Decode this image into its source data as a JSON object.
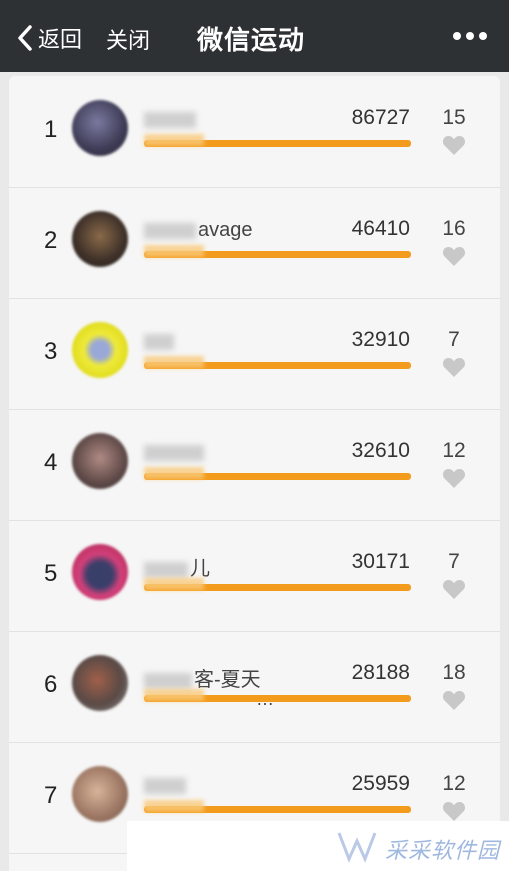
{
  "header": {
    "back_label": "返回",
    "close_label": "关闭",
    "title": "微信运动"
  },
  "rows": [
    {
      "rank": "1",
      "name": "",
      "steps": "86727",
      "likes": "15",
      "progress": 1.0,
      "avatar_color": "#4c4a6a"
    },
    {
      "rank": "2",
      "name": "avage",
      "steps": "46410",
      "likes": "16",
      "progress": 1.0,
      "avatar_color": "#5b4a3a"
    },
    {
      "rank": "3",
      "name": "",
      "steps": "32910",
      "likes": "7",
      "progress": 1.0,
      "avatar_color": "#e9e534"
    },
    {
      "rank": "4",
      "name": "",
      "steps": "32610",
      "likes": "12",
      "progress": 1.0,
      "avatar_color": "#7a6261"
    },
    {
      "rank": "5",
      "name": "儿",
      "steps": "30171",
      "likes": "7",
      "progress": 1.0,
      "avatar_color": "#c8386a"
    },
    {
      "rank": "6",
      "name": "客-夏天",
      "name_sub": "…",
      "steps": "28188",
      "likes": "18",
      "progress": 1.0,
      "avatar_color": "#6b5a55"
    },
    {
      "rank": "7",
      "name": "",
      "steps": "25959",
      "likes": "12",
      "progress": 1.0,
      "avatar_color": "#b58f7a"
    }
  ],
  "watermark": {
    "text": "采采软件园"
  },
  "colors": {
    "accent": "#f39b1c",
    "topbar": "#2e3134",
    "heart": "#c8c8c8"
  }
}
